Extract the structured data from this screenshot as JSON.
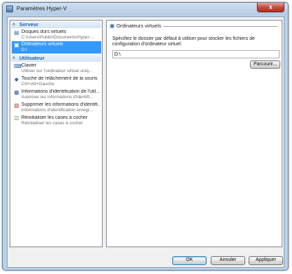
{
  "window": {
    "title": "Paramètres Hyper-V",
    "close_label": "x",
    "icon": "hyper-v-app-icon"
  },
  "sidebar": {
    "sections": [
      {
        "header": "Serveur",
        "items": [
          {
            "icon": "virtual-disks-icon",
            "label": "Disques durs virtuels",
            "sub": "C:\\Users\\Public\\Documents\\Hyper-...",
            "selected": false
          },
          {
            "icon": "virtual-machines-icon",
            "label": "Ordinateurs virtuels",
            "sub": "D:\\",
            "selected": true
          }
        ]
      },
      {
        "header": "Utilisateur",
        "items": [
          {
            "icon": "keyboard-icon",
            "label": "Clavier",
            "sub": "Utiliser sur l'ordinateur virtuel uniq...",
            "selected": false
          },
          {
            "icon": "mouse-release-key-icon",
            "label": "Touche de relâchement de la souris",
            "sub": "Ctrl+Alt+Gauche",
            "selected": false
          },
          {
            "icon": "credentials-icon",
            "label": "Informations d'identification de l'util...",
            "sub": "Autoriser les informations d'identifi...",
            "selected": false
          },
          {
            "icon": "delete-credentials-icon",
            "label": "Supprimer les informations d'identifi...",
            "sub": "Informations d'identification enregi...",
            "selected": false
          },
          {
            "icon": "reset-checkboxes-icon",
            "label": "Réinitialiser les cases à cocher",
            "sub": "Réinitialiser les cases à cocher",
            "selected": false
          }
        ]
      }
    ]
  },
  "main": {
    "heading": "Ordinateurs virtuels",
    "heading_icon": "virtual-machines-icon",
    "description": "Spécifiez le dossier par défaut à utiliser pour stocker les fichiers de configuration d'ordinateur virtuel.",
    "folder_path": "D:\\",
    "browse_label": "Parcourir..."
  },
  "footer": {
    "ok_label": "OK",
    "cancel_label": "Annuler",
    "apply_label": "Appliquer"
  },
  "colors": {
    "selection": "#3399ff",
    "section_header_text": "#1e63a8"
  }
}
